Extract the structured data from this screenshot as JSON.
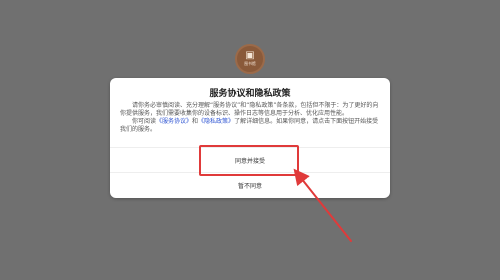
{
  "app": {
    "logo_glyph": "▣",
    "logo_label": "图书馆"
  },
  "dialog": {
    "title": "服务协议和隐私政策",
    "para1": "请你务必审慎阅读、充分理解“服务协议”和“隐私政策”各条款，包括但不限于：为了更好的向你提供服务，我们需要收集你的设备标识、操作日志等信息用于分析、优化应用性能。",
    "para2_prefix": "你可阅读",
    "service_link": "《服务协议》",
    "and_text": "和",
    "privacy_link": "《隐私政策》",
    "para2_suffix": "了解详细信息。如果你同意，请点击下面按钮开始接受我们的服务。",
    "accept_label": "同意并接受",
    "decline_label": "暂不同意"
  },
  "annotation": {
    "highlight_color": "#e03a3a"
  }
}
